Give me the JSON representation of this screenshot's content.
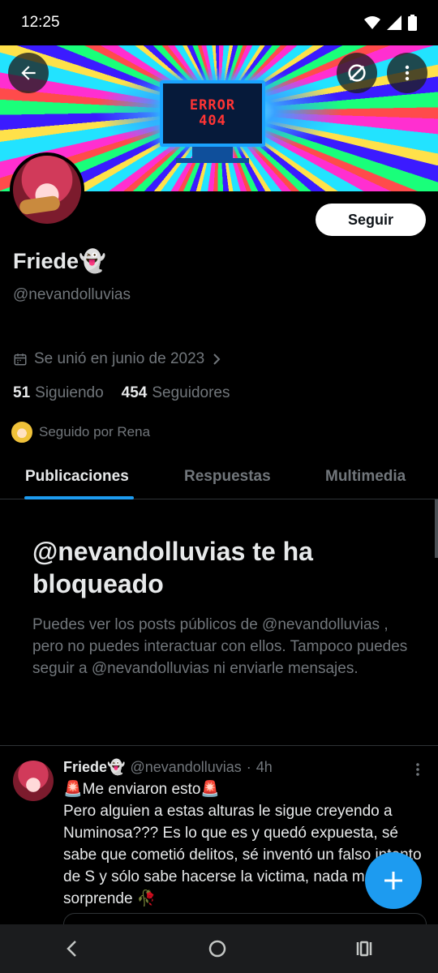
{
  "status": {
    "time": "12:25"
  },
  "banner": {
    "line1": "ERROR",
    "line2": "404"
  },
  "profile": {
    "display_name": "Friede👻",
    "handle": "@nevandolluvias",
    "follow_label": "Seguir",
    "joined": "Se unió en junio de 2023",
    "following_count": "51",
    "following_label": "Siguiendo",
    "followers_count": "454",
    "followers_label": "Seguidores",
    "followed_by": "Seguido por Rena"
  },
  "tabs": [
    {
      "label": "Publicaciones",
      "active": true
    },
    {
      "label": "Respuestas",
      "active": false
    },
    {
      "label": "Multimedia",
      "active": false
    }
  ],
  "blocked": {
    "title": "@nevandolluvias te ha bloqueado",
    "text": "Puedes ver los posts públicos de @nevandolluvias , pero no puedes interactuar con ellos. Tampoco puedes seguir a @nevandolluvias ni enviarle mensajes."
  },
  "post": {
    "name": "Friede👻",
    "handle": "@nevandolluvias",
    "separator": "·",
    "time": "4h",
    "line1": "🚨Me enviaron esto🚨",
    "body": "Pero alguien a estas alturas le sigue creyendo a Numinosa??? Es lo que es y quedó expuesta, sé sabe que cometió delitos, sé inventó un falso intento de S y sólo sabe hacerse la victima, nada me sorprende 🥀"
  },
  "fab": {
    "label": "+"
  },
  "colors": {
    "accent": "#1d9bf0",
    "background": "#000000",
    "muted": "#71767b",
    "text": "#e7e9ea"
  },
  "icons": [
    "back-arrow-icon",
    "no-sync-icon",
    "more-vertical-icon",
    "calendar-icon",
    "chevron-right-icon",
    "plus-icon",
    "nav-back-icon",
    "nav-home-icon",
    "nav-recents-icon",
    "wifi-icon",
    "signal-icon",
    "battery-icon"
  ]
}
